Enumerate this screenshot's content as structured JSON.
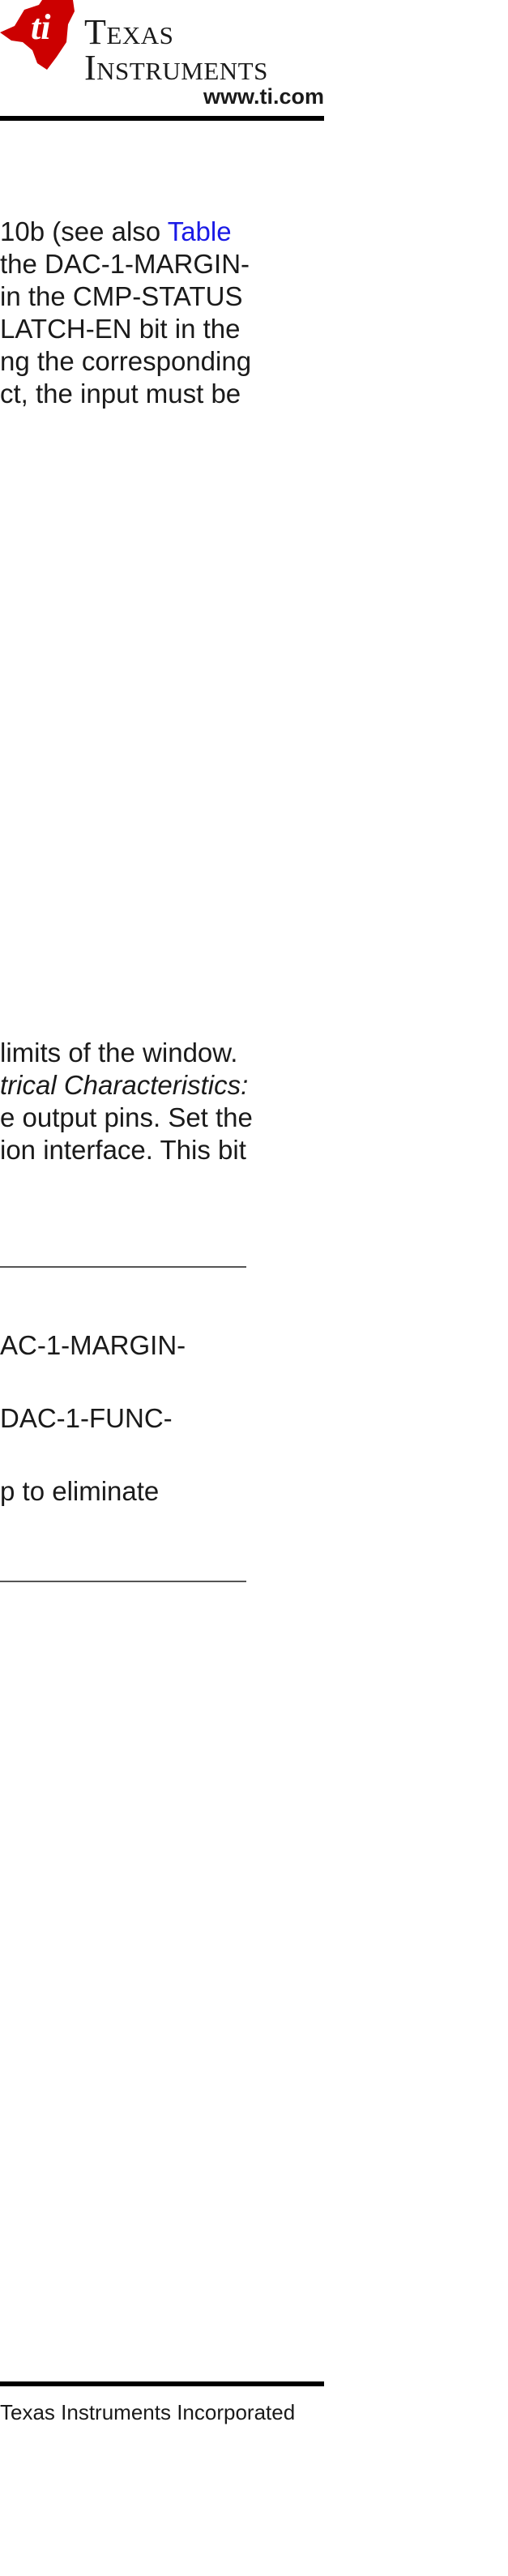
{
  "header": {
    "logo_line1": "Texas",
    "logo_line2": "Instruments",
    "url": "www.ti.com",
    "logo_color": "#cc0000"
  },
  "body": {
    "paragraph1_lines": [
      "10b (see also Table",
      "the DAC-1-MARGIN-",
      "in the CMP-STATUS",
      "LATCH-EN bit in the",
      "ng the corresponding",
      "ct, the input must be"
    ],
    "paragraph1_link": "Table",
    "paragraph2_lines": [
      "limits of the window.",
      "trical Characteristics:",
      "e output pins. Set the",
      "ion interface. This bit"
    ],
    "paragraph2_italic": "trical Characteristics:",
    "note_lines": [
      "AC-1-MARGIN-",
      "DAC-1-FUNC-",
      "p to eliminate"
    ]
  },
  "footer": {
    "copyright": "Texas Instruments Incorporated"
  }
}
